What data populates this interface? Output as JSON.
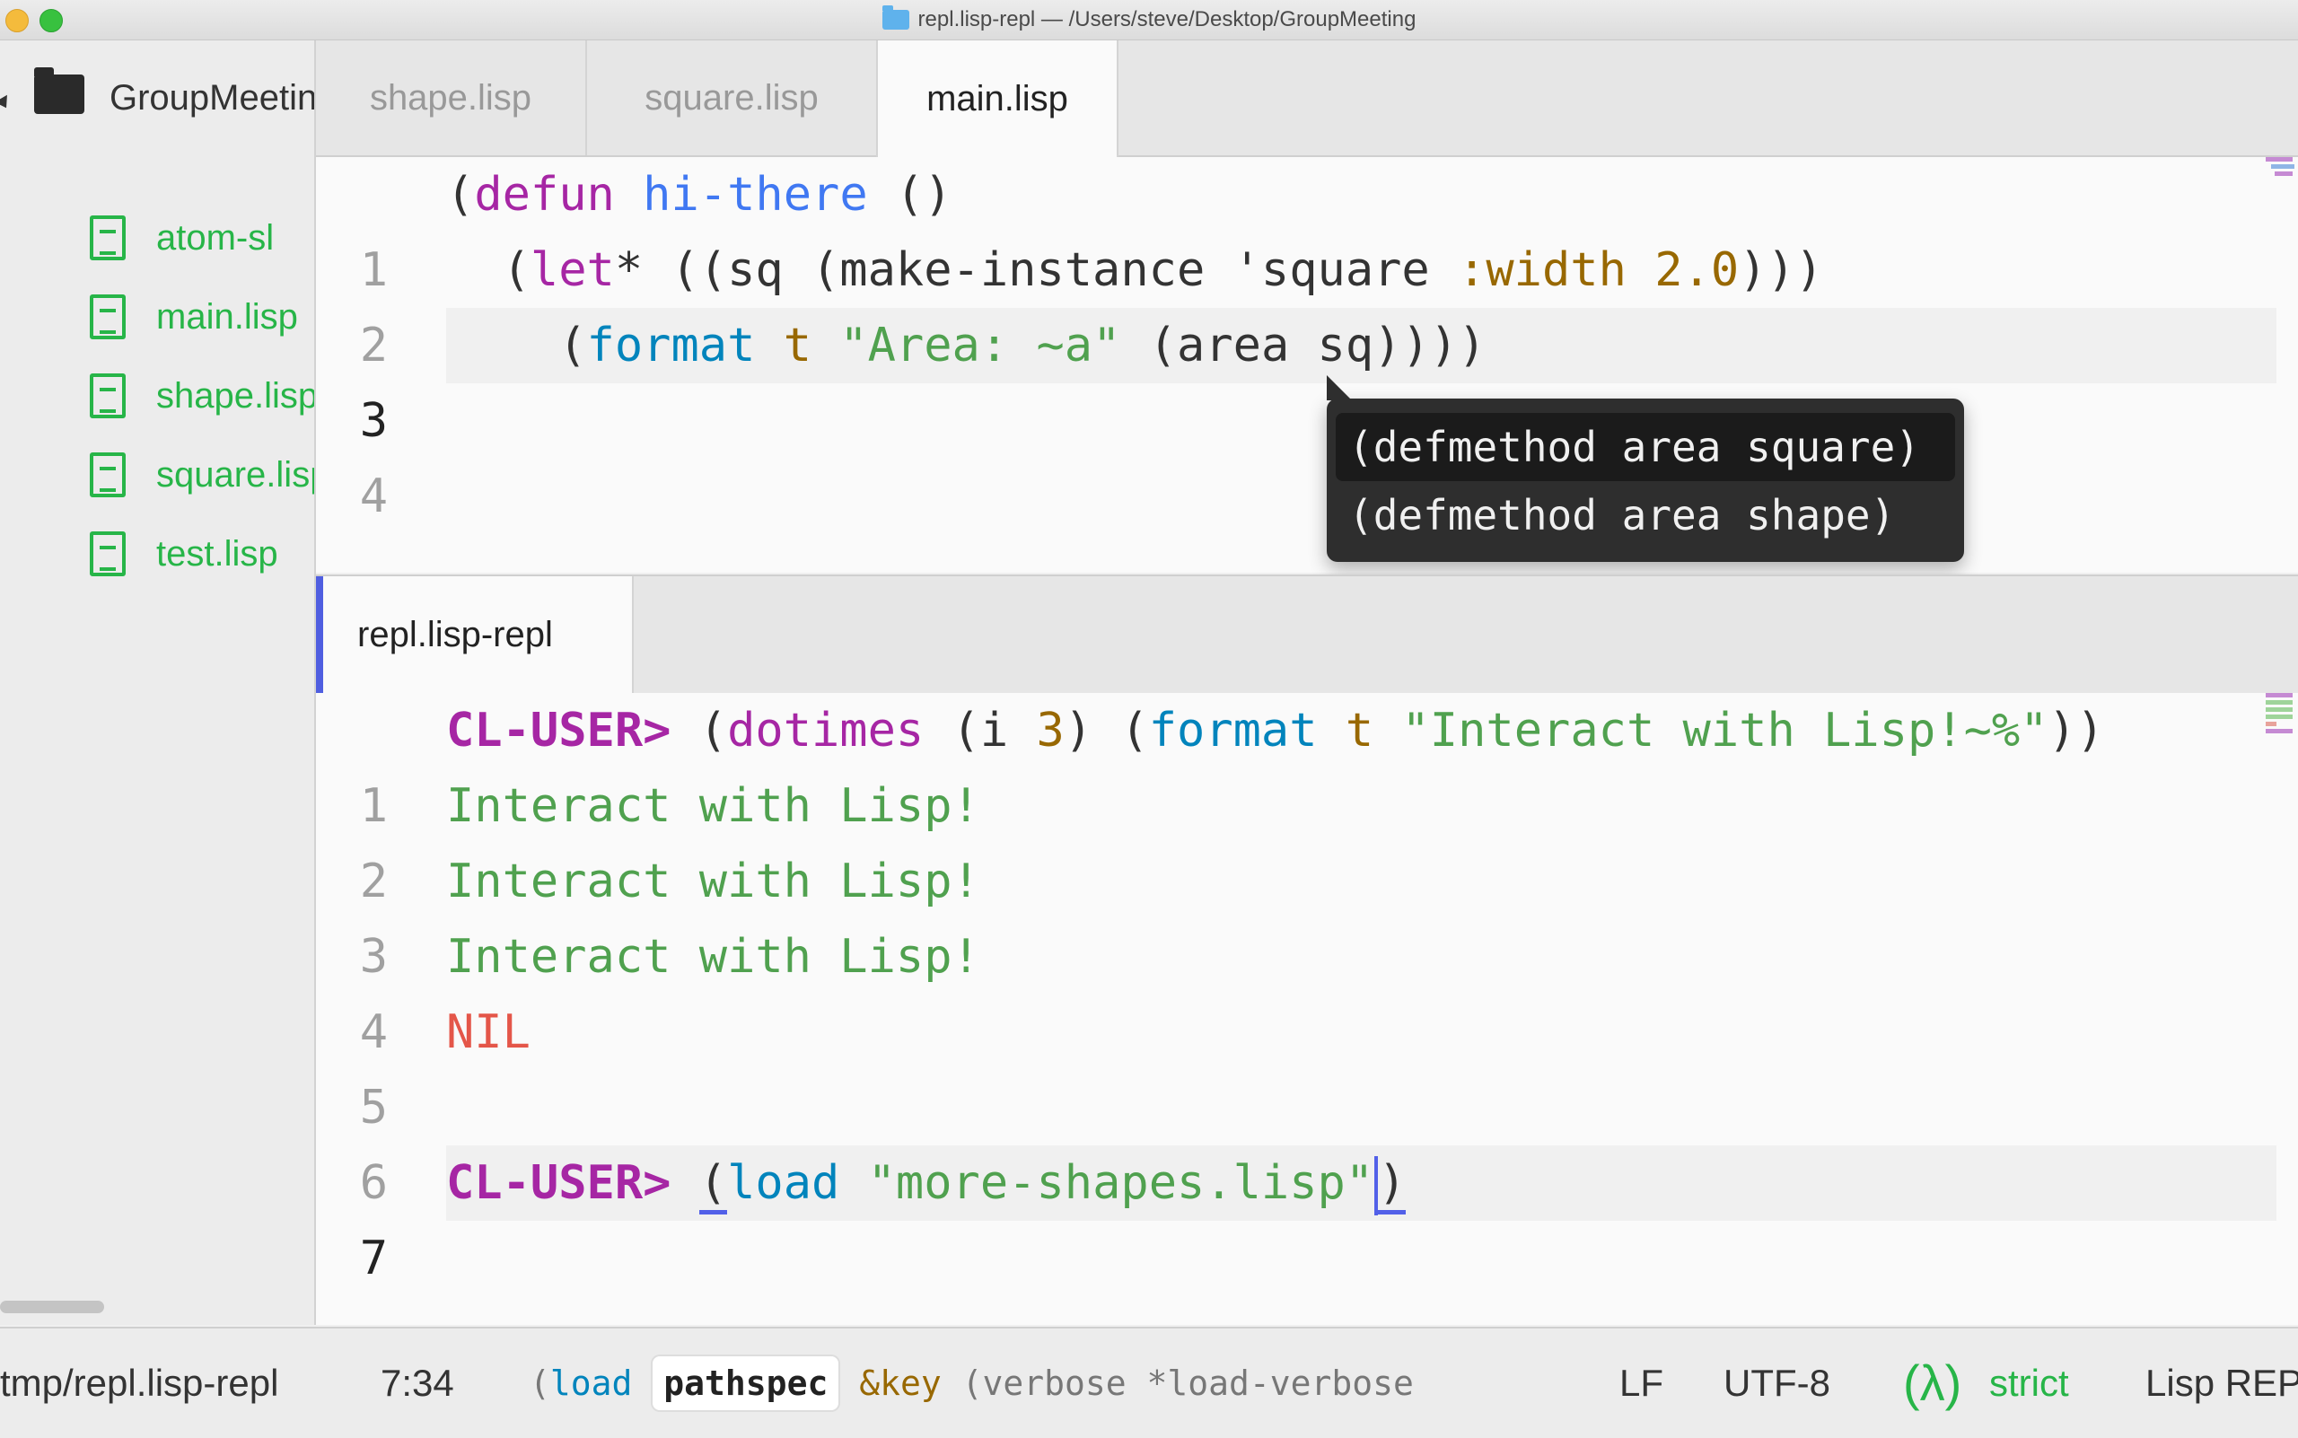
{
  "window": {
    "title": "repl.lisp-repl — /Users/steve/Desktop/GroupMeeting"
  },
  "sidebar": {
    "root": "GroupMeeting",
    "files": [
      "atom-sl",
      "main.lisp",
      "shape.lisp",
      "square.lisp",
      "test.lisp"
    ]
  },
  "top_tabs": [
    {
      "label": "shape.lisp",
      "active": false
    },
    {
      "label": "square.lisp",
      "active": false
    },
    {
      "label": "main.lisp",
      "active": true
    }
  ],
  "top_editor": {
    "line_numbers": [
      "1",
      "2",
      "3",
      "4"
    ],
    "line1": {
      "p1": "(",
      "defun": "defun",
      "sp": " ",
      "name": "hi-there",
      "rest": " ()"
    },
    "line2": {
      "p1": "  (",
      "let": "let",
      "star": "* ((sq (make-instance 'square ",
      "key": ":width",
      "sp": " ",
      "num": "2.0",
      "close": ")))"
    },
    "line3": {
      "p1": "    (",
      "fmt": "format",
      "sp1": " ",
      "t": "t",
      "sp2": " ",
      "str": "\"Area: ~a\"",
      "rest": " (area sq))))"
    }
  },
  "completion": {
    "items": [
      "(defmethod area square)",
      "(defmethod area shape)"
    ],
    "selected": 0
  },
  "bottom_tabs": [
    {
      "label": "repl.lisp-repl",
      "active": true
    }
  ],
  "repl": {
    "line_numbers": [
      "1",
      "2",
      "3",
      "4",
      "5",
      "6",
      "7"
    ],
    "prompt": "CL-USER>",
    "line1": {
      "p1": " (",
      "dotimes": "dotimes",
      "mid": " (i ",
      "num": "3",
      "mid2": ") (",
      "fmt": "format",
      "sp1": " ",
      "t": "t",
      "sp2": " ",
      "str": "\"Interact with Lisp!~%\"",
      "close": "))"
    },
    "output": [
      "Interact with Lisp!",
      "Interact with Lisp!",
      "Interact with Lisp!"
    ],
    "result": "NIL",
    "line7": {
      "sp": " ",
      "open": "(",
      "load": "load",
      "sp2": " ",
      "str": "\"more-shapes.lisp\"",
      "close": ")"
    }
  },
  "statusbar": {
    "path": "tmp/repl.lisp-repl",
    "position": "7:34",
    "sig_open": "(",
    "sig_fn": "load",
    "sig_current": "pathspec",
    "sig_key": "&key",
    "sig_rest": "(verbose *load-verbose",
    "line_ending": "LF",
    "encoding": "UTF-8",
    "lambda": "(λ)",
    "mode": "strict",
    "grammar": "Lisp REPL"
  },
  "colors": {
    "accent": "#4f5ee0",
    "file_green": "#27b548"
  }
}
